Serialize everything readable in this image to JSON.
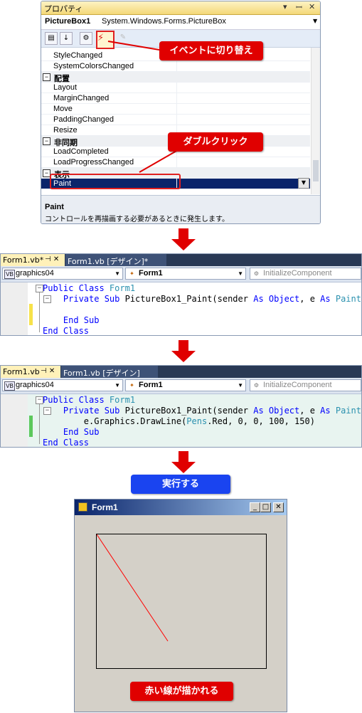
{
  "properties": {
    "title": "プロパティ",
    "title_controls": [
      "▾",
      "ꟷ",
      "✕"
    ],
    "object_name": "PictureBox1",
    "object_type": "System.Windows.Forms.PictureBox",
    "rows": [
      {
        "type": "prop",
        "name": "StyleChanged"
      },
      {
        "type": "prop",
        "name": "SystemColorsChanged"
      },
      {
        "type": "cat",
        "name": "配置"
      },
      {
        "type": "prop",
        "name": "Layout"
      },
      {
        "type": "prop",
        "name": "MarginChanged"
      },
      {
        "type": "prop",
        "name": "Move"
      },
      {
        "type": "prop",
        "name": "PaddingChanged"
      },
      {
        "type": "prop",
        "name": "Resize"
      },
      {
        "type": "cat",
        "name": "非同期"
      },
      {
        "type": "prop",
        "name": "LoadCompleted"
      },
      {
        "type": "prop",
        "name": "LoadProgressChanged"
      },
      {
        "type": "cat",
        "name": "表示"
      },
      {
        "type": "prop",
        "name": "Paint",
        "selected": true
      }
    ],
    "desc_title": "Paint",
    "desc_text": "コントロールを再描画する必要があるときに発生します。"
  },
  "callouts": {
    "event_switch": "イベントに切り替え",
    "double_click": "ダブルクリック",
    "run": "実行する",
    "red_line": "赤い線が描かれる"
  },
  "editor1": {
    "tab_active": "Form1.vb*",
    "tab_pin": "⊣ ✕",
    "tab_other": "Form1.vb [デザイン]*",
    "combo_left": "graphics04",
    "combo_mid": "Form1",
    "combo_right": "InitializeComponent",
    "lines": [
      [
        {
          "t": "Public Class ",
          "c": "kw"
        },
        {
          "t": "Form1",
          "c": "ty"
        }
      ],
      [
        {
          "t": "    Private Sub ",
          "c": "kw"
        },
        {
          "t": "PictureBox1_Paint(sender ",
          "c": ""
        },
        {
          "t": "As ",
          "c": "kw"
        },
        {
          "t": "Object",
          "c": "kw"
        },
        {
          "t": ", e ",
          "c": ""
        },
        {
          "t": "As ",
          "c": "kw"
        },
        {
          "t": "PaintE",
          "c": "ty"
        }
      ],
      [
        {
          "t": "",
          "c": ""
        }
      ],
      [
        {
          "t": "    End Sub",
          "c": "kw"
        }
      ],
      [
        {
          "t": "End Class",
          "c": "kw"
        }
      ]
    ]
  },
  "editor2": {
    "tab_active": "Form1.vb",
    "tab_pin": "⊣ ✕",
    "tab_other": "Form1.vb [デザイン]",
    "combo_left": "graphics04",
    "combo_mid": "Form1",
    "combo_right": "InitializeComponent",
    "lines": [
      [
        {
          "t": "Public Class ",
          "c": "kw"
        },
        {
          "t": "Form1",
          "c": "ty"
        }
      ],
      [
        {
          "t": "    Private Sub ",
          "c": "kw"
        },
        {
          "t": "PictureBox1_Paint(sender ",
          "c": ""
        },
        {
          "t": "As ",
          "c": "kw"
        },
        {
          "t": "Object",
          "c": "kw"
        },
        {
          "t": ", e ",
          "c": ""
        },
        {
          "t": "As ",
          "c": "kw"
        },
        {
          "t": "PaintE",
          "c": "ty"
        }
      ],
      [
        {
          "t": "        e.Graphics.DrawLine(",
          "c": ""
        },
        {
          "t": "Pens",
          "c": "ty"
        },
        {
          "t": ".Red, 0, 0, 100, 150)",
          "c": ""
        }
      ],
      [
        {
          "t": "    End Sub",
          "c": "kw"
        }
      ],
      [
        {
          "t": "End Class",
          "c": "kw"
        }
      ]
    ]
  },
  "form": {
    "title": "Form1",
    "buttons": [
      "_",
      "□",
      "✕"
    ]
  },
  "colors": {
    "callout_red": "#e00000",
    "callout_blue": "#1a44f0",
    "drawn_line": "#ff0000"
  }
}
